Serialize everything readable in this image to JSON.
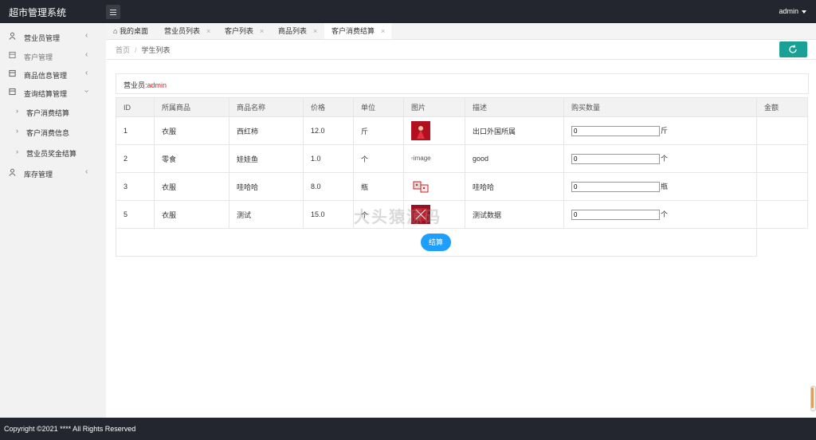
{
  "header": {
    "title": "超市管理系统",
    "user": "admin"
  },
  "sidebar": {
    "items": [
      {
        "label": "营业员管理",
        "icon": "user-icon"
      },
      {
        "label": "客户管理",
        "icon": "form-icon"
      },
      {
        "label": "商品信息管理",
        "icon": "form-icon"
      },
      {
        "label": "查询结算管理",
        "icon": "form-icon",
        "expanded": true
      },
      {
        "label": "库存管理",
        "icon": "user-icon"
      }
    ],
    "subitems": [
      {
        "label": "客户消费结算"
      },
      {
        "label": "客户消费信息"
      },
      {
        "label": "营业员奖金结算"
      }
    ]
  },
  "tabs": [
    {
      "label": "我的桌面",
      "icon": "home-icon"
    },
    {
      "label": "营业员列表"
    },
    {
      "label": "客户列表"
    },
    {
      "label": "商品列表"
    },
    {
      "label": "客户消费结算",
      "active": true
    }
  ],
  "breadcrumb": {
    "home": "首页",
    "sep": "/",
    "current": "学生列表"
  },
  "sales": {
    "label": "营业员:",
    "value": "admin"
  },
  "table": {
    "headers": [
      "ID",
      "所属商品",
      "商品名称",
      "价格",
      "单位",
      "图片",
      "描述",
      "购买数量",
      "金额"
    ],
    "rows": [
      {
        "id": "1",
        "category": "衣服",
        "name": "西红柿",
        "price": "12.0",
        "unit": "斤",
        "image": "red-photo",
        "desc": "出口外国所属",
        "qty": "0",
        "qty_unit": "斤",
        "amount": ""
      },
      {
        "id": "2",
        "category": "零食",
        "name": "娃娃鱼",
        "price": "1.0",
        "unit": "个",
        "image": "broken",
        "image_alt": "image",
        "desc": "good",
        "qty": "0",
        "qty_unit": "个",
        "amount": ""
      },
      {
        "id": "3",
        "category": "衣服",
        "name": "哇哈哈",
        "price": "8.0",
        "unit": "瓶",
        "image": "dice-photo",
        "desc": "哇哈哈",
        "qty": "0",
        "qty_unit": "瓶",
        "amount": ""
      },
      {
        "id": "5",
        "category": "衣服",
        "name": "测试",
        "price": "15.0",
        "unit": "个",
        "image": "red-cloth",
        "desc": "测试数据",
        "qty": "0",
        "qty_unit": "个",
        "amount": ""
      }
    ]
  },
  "settle_button": "结算",
  "watermark": "大头猿源码",
  "footer": {
    "copyright": "Copyright ©2021 **** All Rights Reserved"
  },
  "colors": {
    "accent": "#1aa094",
    "primary": "#1e9fff",
    "topbar": "#23262e",
    "danger": "#e02020"
  }
}
